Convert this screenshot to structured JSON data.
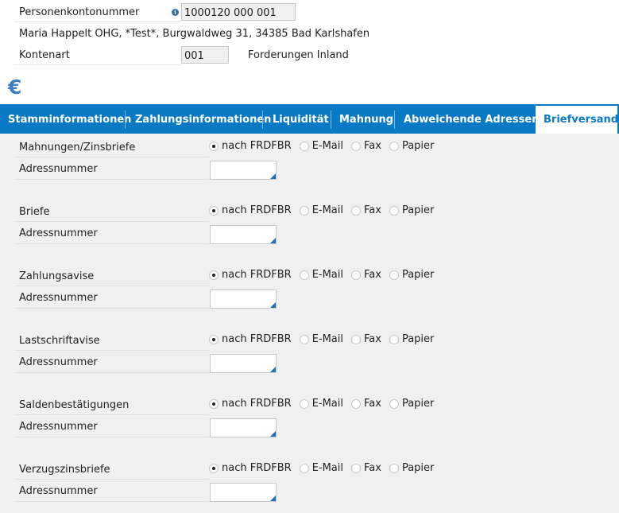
{
  "header": {
    "account_label": "Personenkontonummer",
    "account_value": "1000120 000 001",
    "address_text": "Maria Happelt OHG, *Test*, Burgwaldweg 31, 34385 Bad Karlshafen",
    "konto_label": "Kontenart",
    "konto_value": "001",
    "konto_desc": "Forderungen Inland",
    "info_glyph": "i",
    "currency_symbol": "€"
  },
  "tabs": [
    {
      "label": "Stamminformationen"
    },
    {
      "label": "Zahlungsinformationen"
    },
    {
      "label": "Liquidität"
    },
    {
      "label": "Mahnung"
    },
    {
      "label": "Abweichende Adressen"
    },
    {
      "label": "Briefversand",
      "active": true
    }
  ],
  "address_label": "Adressnummer",
  "radio_options": [
    "nach FRDFBR",
    "E-Mail",
    "Fax",
    "Papier"
  ],
  "sections": [
    {
      "label": "Mahnungen/Zinsbriefe",
      "selected": "nach FRDFBR",
      "address_number": ""
    },
    {
      "label": "Briefe",
      "selected": "nach FRDFBR",
      "address_number": ""
    },
    {
      "label": "Zahlungsavise",
      "selected": "nach FRDFBR",
      "address_number": ""
    },
    {
      "label": "Lastschriftavise",
      "selected": "nach FRDFBR",
      "address_number": ""
    },
    {
      "label": "Saldenbestätigungen",
      "selected": "nach FRDFBR",
      "address_number": ""
    },
    {
      "label": "Verzugszinsbriefe",
      "selected": "nach FRDFBR",
      "address_number": ""
    }
  ],
  "colors": {
    "tab_bar": "#0a79c6",
    "content_bg": "#f0f0f0",
    "euro": "#3f7fc1"
  }
}
